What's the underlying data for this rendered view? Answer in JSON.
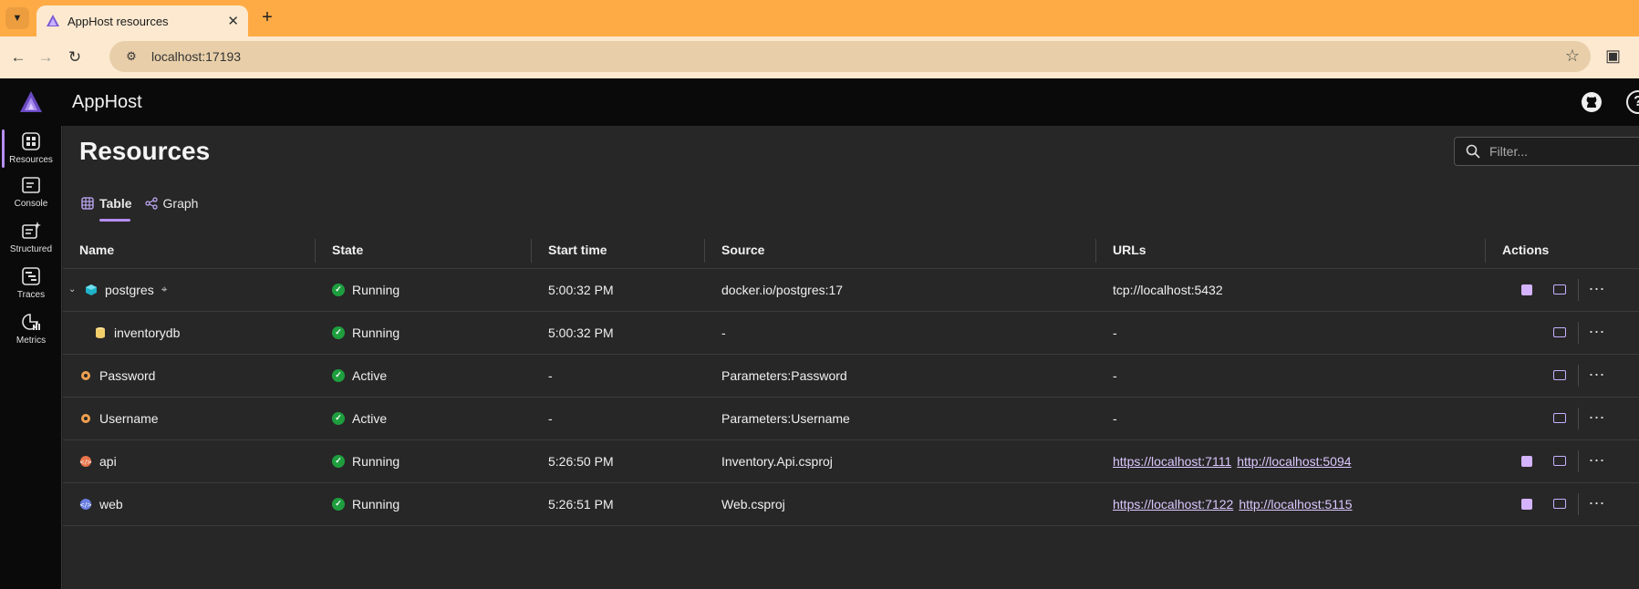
{
  "browser": {
    "tab_title": "AppHost resources",
    "address": "localhost:17193"
  },
  "app": {
    "title": "AppHost"
  },
  "sidenav": [
    {
      "label": "Resources",
      "icon": "resources-icon",
      "active": true
    },
    {
      "label": "Console",
      "icon": "console-icon",
      "active": false
    },
    {
      "label": "Structured",
      "icon": "structured-icon",
      "active": false
    },
    {
      "label": "Traces",
      "icon": "traces-icon",
      "active": false
    },
    {
      "label": "Metrics",
      "icon": "metrics-icon",
      "active": false
    }
  ],
  "page": {
    "title": "Resources",
    "filter_placeholder": "Filter...",
    "view_tabs": [
      {
        "label": "Table",
        "active": true
      },
      {
        "label": "Graph",
        "active": false
      }
    ]
  },
  "table": {
    "columns": [
      "Name",
      "State",
      "Start time",
      "Source",
      "URLs",
      "Actions"
    ],
    "rows": [
      {
        "name": "postgres",
        "icon": "container-icon",
        "expandable": true,
        "pinned": true,
        "indent": false,
        "state": "Running",
        "start": "5:00:32 PM",
        "source": "docker.io/postgres:17",
        "urls": [],
        "url_text": "tcp://localhost:5432",
        "has_stop": true
      },
      {
        "name": "inventorydb",
        "icon": "database-icon",
        "expandable": false,
        "pinned": false,
        "indent": true,
        "state": "Running",
        "start": "5:00:32 PM",
        "source": "-",
        "urls": [],
        "url_text": "-",
        "has_stop": false
      },
      {
        "name": "Password",
        "icon": "parameter-icon",
        "expandable": false,
        "pinned": false,
        "indent": false,
        "state": "Active",
        "start": "-",
        "source": "Parameters:Password",
        "urls": [],
        "url_text": "-",
        "has_stop": false
      },
      {
        "name": "Username",
        "icon": "parameter-icon",
        "expandable": false,
        "pinned": false,
        "indent": false,
        "state": "Active",
        "start": "-",
        "source": "Parameters:Username",
        "urls": [],
        "url_text": "-",
        "has_stop": false
      },
      {
        "name": "api",
        "icon": "project-icon",
        "expandable": false,
        "pinned": false,
        "indent": false,
        "state": "Running",
        "start": "5:26:50 PM",
        "source": "Inventory.Api.csproj",
        "urls": [
          "https://localhost:7111",
          "http://localhost:5094"
        ],
        "url_text": "",
        "has_stop": true
      },
      {
        "name": "web",
        "icon": "project-icon",
        "expandable": false,
        "pinned": false,
        "indent": false,
        "state": "Running",
        "start": "5:26:51 PM",
        "source": "Web.csproj",
        "urls": [
          "https://localhost:7122",
          "http://localhost:5115"
        ],
        "url_text": "",
        "has_stop": true
      }
    ]
  },
  "colors": {
    "accent": "#b68ef5",
    "browser_frame": "#ffab45",
    "running": "#1e9e3e",
    "link": "#dcc8ff"
  }
}
